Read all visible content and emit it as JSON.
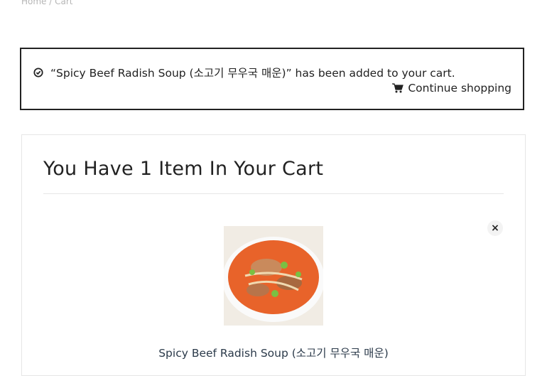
{
  "breadcrumb": {
    "home": "Home",
    "separator": "/",
    "current": "Cart"
  },
  "notice": {
    "message": "“Spicy Beef Radish Soup (소고기 무우국 매운)” has been added to your cart.",
    "continue_label": "Continue shopping"
  },
  "cart": {
    "title": "You Have 1 Item In Your Cart",
    "remove_symbol": "×",
    "items": [
      {
        "name": "Spicy Beef Radish Soup (소고기 무우국 매운)"
      }
    ]
  },
  "colors": {
    "border_dark": "#222222",
    "border_light": "#e6e6e6",
    "soup": "#e8632a"
  },
  "icons": {
    "notice": "check-circle-icon",
    "continue": "cart-icon",
    "remove": "close-icon"
  }
}
